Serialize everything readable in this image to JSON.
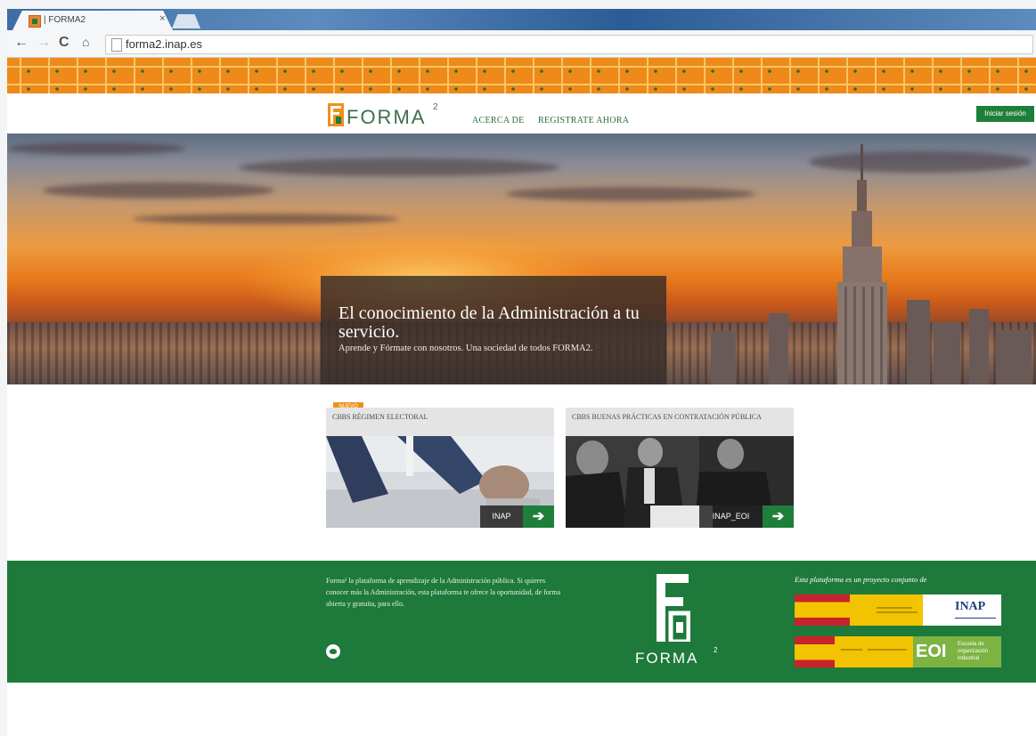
{
  "browser": {
    "tab_title": "| FORMA2",
    "tab_close": "×",
    "url": "forma2.inap.es"
  },
  "header": {
    "logo_text": "FORMA",
    "logo_sup": "2",
    "nav": [
      "ACERCA DE",
      "REGISTRATE AHORA"
    ],
    "login_label": "Iniciar sesión"
  },
  "hero": {
    "title": "El conocimiento de la Administración a tu servicio.",
    "subtitle": "Aprende y Fórmate con nosotros. Una sociedad de todos FORMA2."
  },
  "courses": [
    {
      "badge": "NUEVO",
      "title": "CBBS RÉGIMEN ELECTORAL",
      "tag": "INAP",
      "arrow": "➔"
    },
    {
      "title": "CBBS BUENAS PRÁCTICAS EN CONTRATACIÓN PÚBLICA",
      "tag": "INAP_EOI",
      "arrow": "➔"
    }
  ],
  "footer": {
    "description": "Forma² la plataforma de aprendizaje de la Administración pública. Si quieres conocer más la Administración, esta plataforma te ofrece la oportunidad, de forma abierta y gratuita, para ello.",
    "logo_text": "FORMA",
    "logo_sup": "2",
    "partners_title": "Esta plataforma es un proyecto conjunto de",
    "partners": [
      "INAP",
      "EOI"
    ],
    "eoi_text": "Escuela de organización industrial"
  },
  "colors": {
    "brand_green": "#1e7f3a",
    "orange": "#ee8a17"
  },
  "icons": [
    "back-arrow-icon",
    "forward-arrow-icon",
    "reload-icon",
    "home-icon",
    "page-icon",
    "twitter-icon",
    "arrow-right-icon"
  ]
}
